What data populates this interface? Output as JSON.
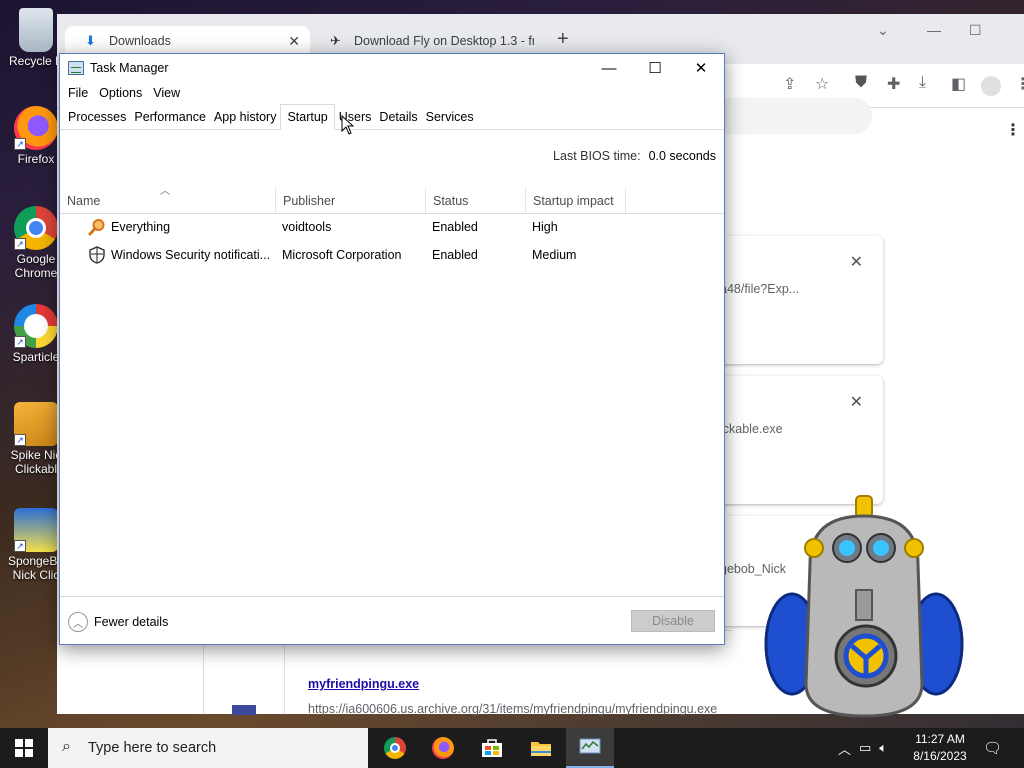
{
  "desktop": {
    "icons": [
      {
        "label": "Recycle Bin",
        "display": "Recycle E"
      },
      {
        "label": "Firefox",
        "display": "Firefox"
      },
      {
        "label": "Google Chrome",
        "display_line1": "Google",
        "display_line2": "Chrome"
      },
      {
        "label": "Sparticle",
        "display": "Sparticle"
      },
      {
        "label": "Spike Nick Clickable",
        "display_line1": "Spike Nic",
        "display_line2": "Clickabl"
      },
      {
        "label": "SpongeBob Nick Clickable",
        "display_line1": "SpongeBo",
        "display_line2": "Nick Clic"
      }
    ]
  },
  "browser": {
    "tabs": [
      {
        "label": "Downloads",
        "active": true
      },
      {
        "label": "Download Fly on Desktop 1.3 - fr",
        "active": false
      }
    ],
    "downloads_visible": {
      "card1_fragment": "a48/file?Exp...",
      "card2_fragment": "ickable.exe",
      "card3_fragment": "gebob_Nick",
      "file_name": "myfriendpingu.exe",
      "file_url": "https://ia600606.us.archive.org/31/items/myfriendpingu/myfriendpingu.exe"
    }
  },
  "task_manager": {
    "title": "Task Manager",
    "menu": [
      "File",
      "Options",
      "View"
    ],
    "tabs": [
      "Processes",
      "Performance",
      "App history",
      "Startup",
      "Users",
      "Details",
      "Services"
    ],
    "active_tab": "Startup",
    "bios_label": "Last BIOS time:",
    "bios_value": "0.0 seconds",
    "columns": [
      "Name",
      "Publisher",
      "Status",
      "Startup impact"
    ],
    "rows": [
      {
        "icon": "everything-search-icon",
        "name": "Everything",
        "publisher": "voidtools",
        "status": "Enabled",
        "impact": "High"
      },
      {
        "icon": "shield-icon",
        "name": "Windows Security notificati...",
        "publisher": "Microsoft Corporation",
        "status": "Enabled",
        "impact": "Medium"
      }
    ],
    "fewer_details": "Fewer details",
    "disable_button": "Disable"
  },
  "taskbar": {
    "search_placeholder": "Type here to search",
    "pinned": [
      "chrome-icon",
      "firefox-icon",
      "store-icon",
      "file-explorer-icon",
      "task-manager-icon"
    ],
    "time": "11:27 AM",
    "date": "8/16/2023"
  }
}
